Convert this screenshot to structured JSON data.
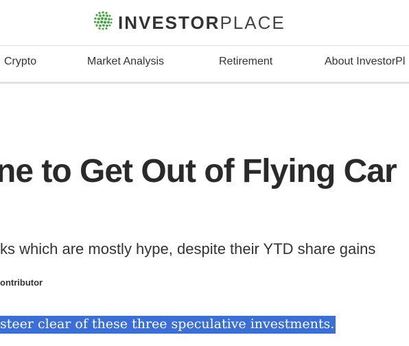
{
  "header": {
    "logo_bold": "INVESTOR",
    "logo_light": "PLACE",
    "logo_icon": "globe-dots-icon",
    "brand_color": "#3aa635"
  },
  "nav": {
    "items": [
      {
        "label": "Crypto"
      },
      {
        "label": "Market Analysis"
      },
      {
        "label": "Retirement"
      },
      {
        "label": "About InvestorPl"
      }
    ]
  },
  "article": {
    "headline": "ne to Get Out of Flying Car",
    "subhead": "ks which are mostly hype, despite their YTD share gains",
    "byline": "ontributor",
    "summary": "steer clear of these three speculative investments.",
    "selection_color": "#3b6fd8"
  }
}
